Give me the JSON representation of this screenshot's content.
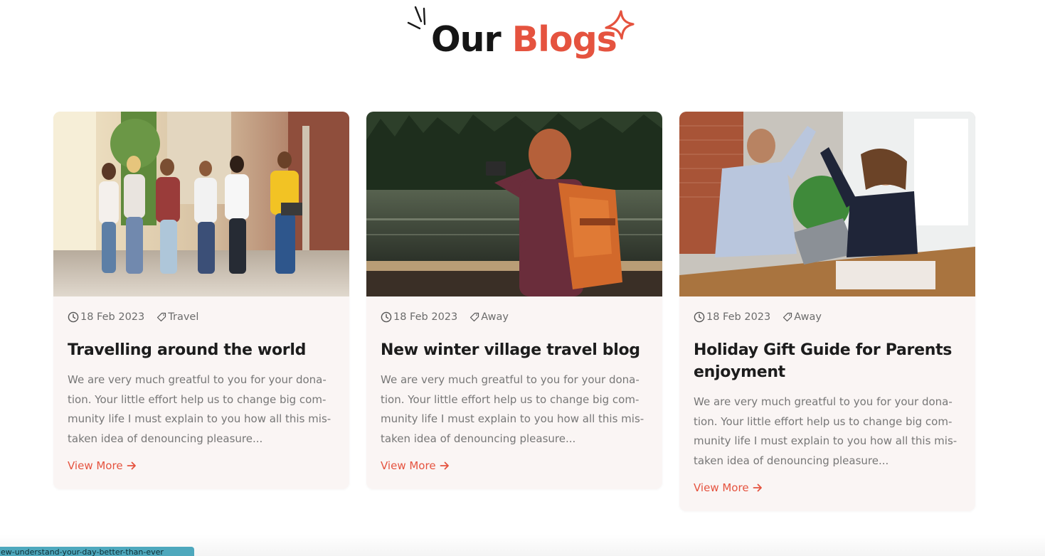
{
  "section": {
    "title_part1": "Our",
    "title_part2": "Blogs",
    "accent_color": "#e5533f"
  },
  "cards": [
    {
      "image": "photo of students walking together in a corridor",
      "date": "18 Feb 2023",
      "tag": "Travel",
      "title": "Travelling around the world",
      "description": "We are very much greatful to you for your dona-tion. Your little effort help us to change big com-munity life I must explain to you how all this mis-taken idea of denouncing pleasure...",
      "link_label": "View More"
    },
    {
      "image": "photo of woman with backpack photographing a lake",
      "date": "18 Feb 2023",
      "tag": "Away",
      "title": "New winter village travel blog",
      "description": "We are very much greatful to you for your dona-tion. Your little effort help us to change big com-munity life I must explain to you how all this mis-taken idea of denouncing pleasure...",
      "link_label": "View More"
    },
    {
      "image": "photo of two coworkers giving a high five at a desk",
      "date": "18 Feb 2023",
      "tag": "Away",
      "title": "Holiday Gift Guide for Parents enjoyment",
      "description": "We are very much greatful to you for your dona-tion. Your little effort help us to change big com-munity life I must explain to you how all this mis-taken idea of denouncing pleasure...",
      "link_label": "View More"
    }
  ],
  "status_bar": {
    "url_text": "s-view-understand-your-day-better-than-ever"
  },
  "icons": {
    "date": "clock-icon",
    "tag": "tag-icon",
    "link": "arrow-right-icon"
  }
}
